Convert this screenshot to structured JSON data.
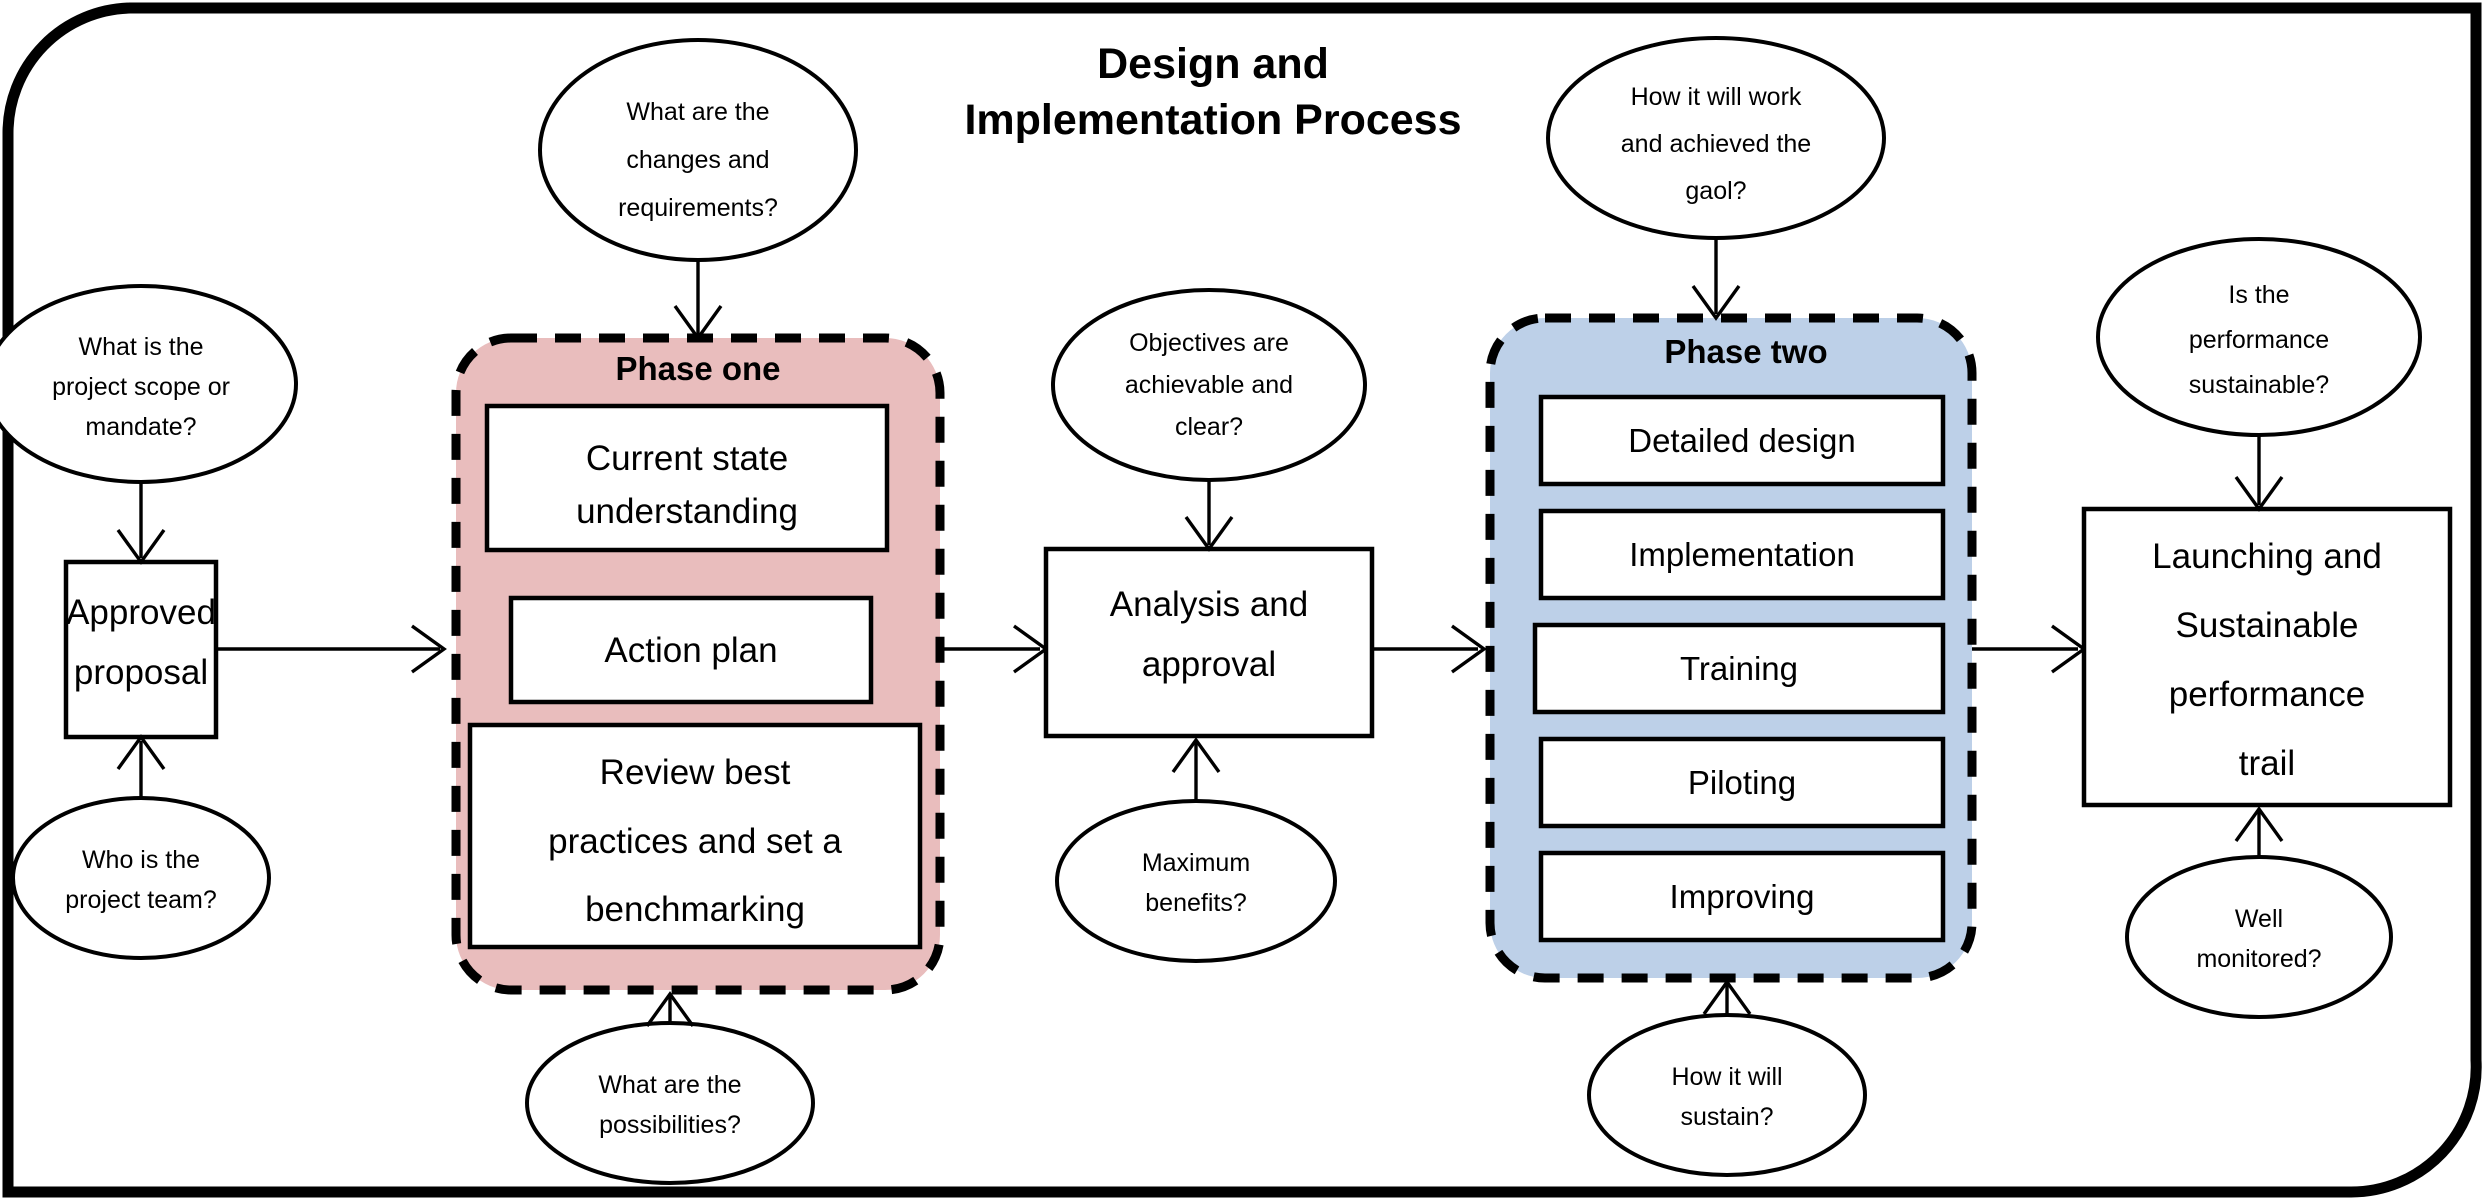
{
  "title": {
    "line1": "Design and",
    "line2": "Implementation Process"
  },
  "colors": {
    "phase_one_fill": "#E9BDBD",
    "phase_two_fill": "#BDD0E8",
    "outline": "#000000",
    "node_fill": "#FFFFFF"
  },
  "flow_nodes": [
    {
      "id": "approved-proposal",
      "lines": [
        "Approved",
        "proposal"
      ]
    },
    {
      "id": "analysis-approval",
      "lines": [
        "Analysis and",
        "approval"
      ]
    },
    {
      "id": "launching-sustainable",
      "lines": [
        "Launching and",
        "Sustainable",
        "performance",
        "trail"
      ]
    }
  ],
  "phases": [
    {
      "id": "phase-one",
      "label": "Phase one",
      "fill": "#E9BDBD",
      "steps": [
        {
          "id": "current-state-understanding",
          "lines": [
            "Current state",
            "understanding"
          ]
        },
        {
          "id": "action-plan",
          "lines": [
            "Action plan"
          ]
        },
        {
          "id": "review-best-practices",
          "lines": [
            "Review best",
            "practices and set a",
            "benchmarking"
          ]
        }
      ]
    },
    {
      "id": "phase-two",
      "label": "Phase two",
      "fill": "#BDD0E8",
      "steps": [
        {
          "id": "detailed-design",
          "lines": [
            "Detailed design"
          ]
        },
        {
          "id": "implementation",
          "lines": [
            "Implementation"
          ]
        },
        {
          "id": "training",
          "lines": [
            "Training"
          ]
        },
        {
          "id": "piloting",
          "lines": [
            "Piloting"
          ]
        },
        {
          "id": "improving",
          "lines": [
            "Improving"
          ]
        }
      ]
    }
  ],
  "questions": [
    {
      "id": "q-project-scope",
      "lines": [
        "What is the",
        "project scope or",
        "mandate?"
      ],
      "target": "approved-proposal",
      "position": "above"
    },
    {
      "id": "q-project-team",
      "lines": [
        "Who is the",
        "project team?"
      ],
      "target": "approved-proposal",
      "position": "below"
    },
    {
      "id": "q-changes-requirements",
      "lines": [
        "What are the",
        "changes and",
        "requirements?"
      ],
      "target": "phase-one",
      "position": "above"
    },
    {
      "id": "q-possibilities",
      "lines": [
        "What are the",
        "possibilities?"
      ],
      "target": "phase-one",
      "position": "below"
    },
    {
      "id": "q-objectives-achievable",
      "lines": [
        "Objectives are",
        "achievable and",
        "clear?"
      ],
      "target": "analysis-approval",
      "position": "above"
    },
    {
      "id": "q-maximum-benefits",
      "lines": [
        "Maximum",
        "benefits?"
      ],
      "target": "analysis-approval",
      "position": "below"
    },
    {
      "id": "q-how-it-will-work",
      "lines": [
        "How it will work",
        "and achieved the",
        "gaol?"
      ],
      "target": "phase-two",
      "position": "above"
    },
    {
      "id": "q-how-it-will-sustain",
      "lines": [
        "How it will",
        "sustain?"
      ],
      "target": "phase-two",
      "position": "below"
    },
    {
      "id": "q-performance-sustainable",
      "lines": [
        "Is the",
        "performance",
        "sustainable?"
      ],
      "target": "launching-sustainable",
      "position": "above"
    },
    {
      "id": "q-well-monitored",
      "lines": [
        "Well",
        "monitored?"
      ],
      "target": "launching-sustainable",
      "position": "below"
    }
  ]
}
